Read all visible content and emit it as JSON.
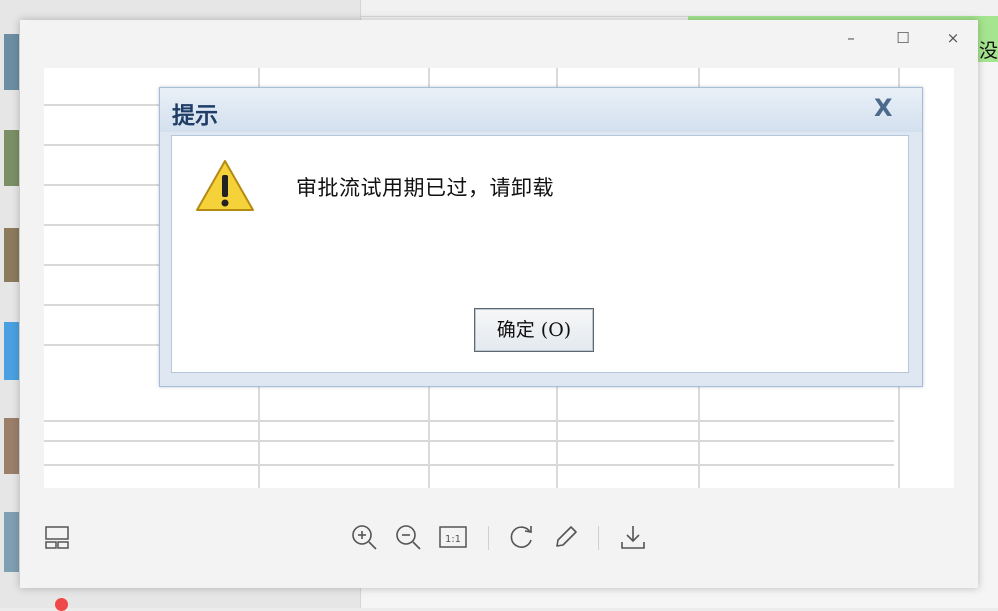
{
  "background": {
    "right_header_text": "没"
  },
  "viewer": {
    "window_controls": {
      "minimize": "–",
      "maximize": "☐",
      "close": "×"
    },
    "dialog": {
      "title": "提示",
      "close_glyph": "X",
      "message": "审批流试用期已过，请卸载",
      "ok_label": "确定 (O)"
    },
    "toolbar": {
      "actual_size_label": "1:1"
    }
  }
}
